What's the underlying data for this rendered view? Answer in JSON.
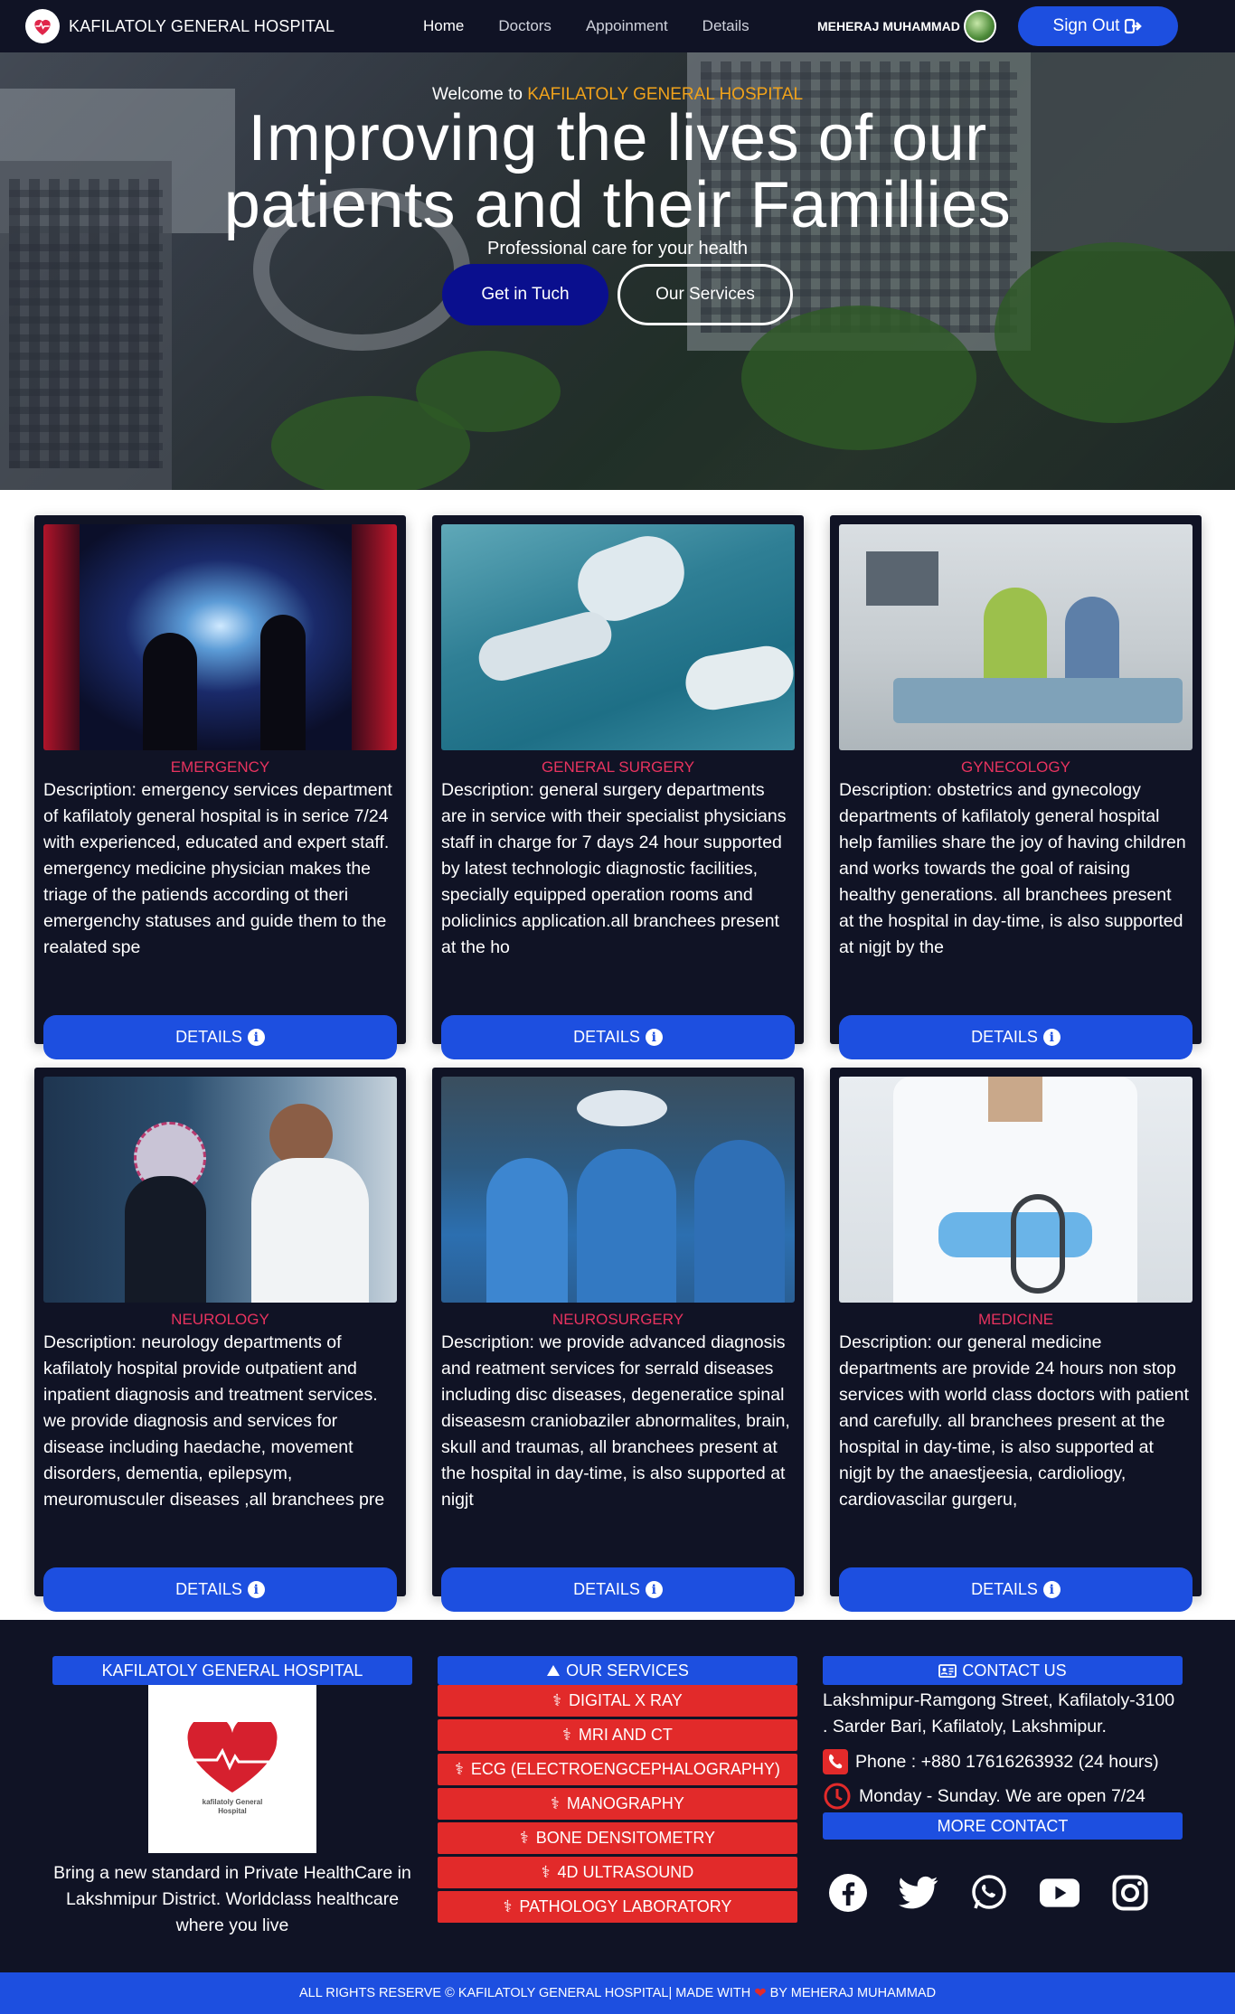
{
  "nav": {
    "brand": "KAFILATOLY GENERAL HOSPITAL",
    "links": [
      "Home",
      "Doctors",
      "Appoinment",
      "Details"
    ],
    "user_name": "MEHERAJ MUHAMMAD",
    "signout_label": "Sign Out"
  },
  "hero": {
    "welcome_prefix": "Welcome to",
    "welcome_accent": "KAFILATOLY GENERAL HOSPITAL",
    "title_line1": "Improving the lives of our",
    "title_line2": "patients and their Famillies",
    "subtitle": "Professional care for your health",
    "btn_contact": "Get in Tuch",
    "btn_services": "Our Services"
  },
  "cards": [
    {
      "title": "EMERGENCY",
      "desc": "Description: emergency services department of kafilatoly general hospital is in serice 7/24 with experienced, educated and expert staff. emergency medicine physician makes the triage of the patiends according ot theri emergenchy statuses and guide them to the realated spe",
      "button": "DETAILS"
    },
    {
      "title": "GENERAL SURGERY",
      "desc": "Description: general surgery departments are in service with their specialist physicians staff in charge for 7 days 24 hour supported by latest technologic diagnostic facilities, specially equipped operation rooms and policlinics application.all branchees present at the ho",
      "button": "DETAILS"
    },
    {
      "title": "GYNECOLOGY",
      "desc": "Description: obstetrics and gynecology departments of kafilatoly general hospital help families share the joy of having children and works towards the goal of raising healthy generations. all branchees present at the hospital in day-time, is also supported at nigjt by the",
      "button": "DETAILS"
    },
    {
      "title": "NEUROLOGY",
      "desc": "Description: neurology departments of kafilatoly hospital provide outpatient and inpatient diagnosis and treatment services. we provide diagnosis and services for disease including haedache, movement disorders, dementia, epilepsym, meuromusculer diseases ,all branchees pre",
      "button": "DETAILS"
    },
    {
      "title": "NEUROSURGERY",
      "desc": "Description: we provide advanced diagnosis and reatment services for serrald diseases including disc diseases, degeneratice spinal diseasesm craniobaziler abnormalites, brain, skull and traumas, all branchees present at the hospital in day-time, is also supported at nigjt",
      "button": "DETAILS"
    },
    {
      "title": "MEDICINE",
      "desc": "Description: our general medicine departments are provide 24 hours non stop services with world class doctors with patient and carefully. all branchees present at the hospital in day-time, is also supported at nigjt by the anaestjeesia, cardioliogy, cardiovascilar gurgeru,",
      "button": "DETAILS"
    }
  ],
  "footer": {
    "about_title": "KAFILATOLY GENERAL HOSPITAL",
    "logo_text": "kafilatoly General Hospital",
    "tagline": "Bring a new standard in Private HealthCare in Lakshmipur District. Worldclass healthcare where you live",
    "services_title": "OUR SERVICES",
    "services": [
      "DIGITAL X RAY",
      "MRI AND CT",
      "ECG (ELECTROENGCEPHALOGRAPHY)",
      "MANOGRAPHY",
      "BONE DENSITOMETRY",
      "4D ULTRASOUND",
      "PATHOLOGY LABORATORY"
    ],
    "contact_title": "CONTACT US",
    "address": "Lakshmipur-Ramgong Street, Kafilatoly-3100 . Sarder Bari, Kafilatoly, Lakshmipur.",
    "phone": "Phone : +880 17616263932 (24 hours)",
    "hours": "Monday - Sunday. We are open 7/24",
    "more_contact": "MORE CONTACT",
    "social": [
      "facebook-icon",
      "twitter-icon",
      "whatsapp-icon",
      "youtube-icon",
      "instagram-icon"
    ]
  },
  "copyright": {
    "left": "ALL RIGHTS RESERVE © KAFILATOLY GENERAL HOSPITAL| MADE WITH",
    "right": "BY MEHERAJ MUHAMMAD"
  },
  "colors": {
    "navy": "#101325",
    "blue": "#1d4fe0",
    "red": "#e22a2a",
    "accent_orange": "#f0a21b",
    "card_title": "#e8335f"
  }
}
